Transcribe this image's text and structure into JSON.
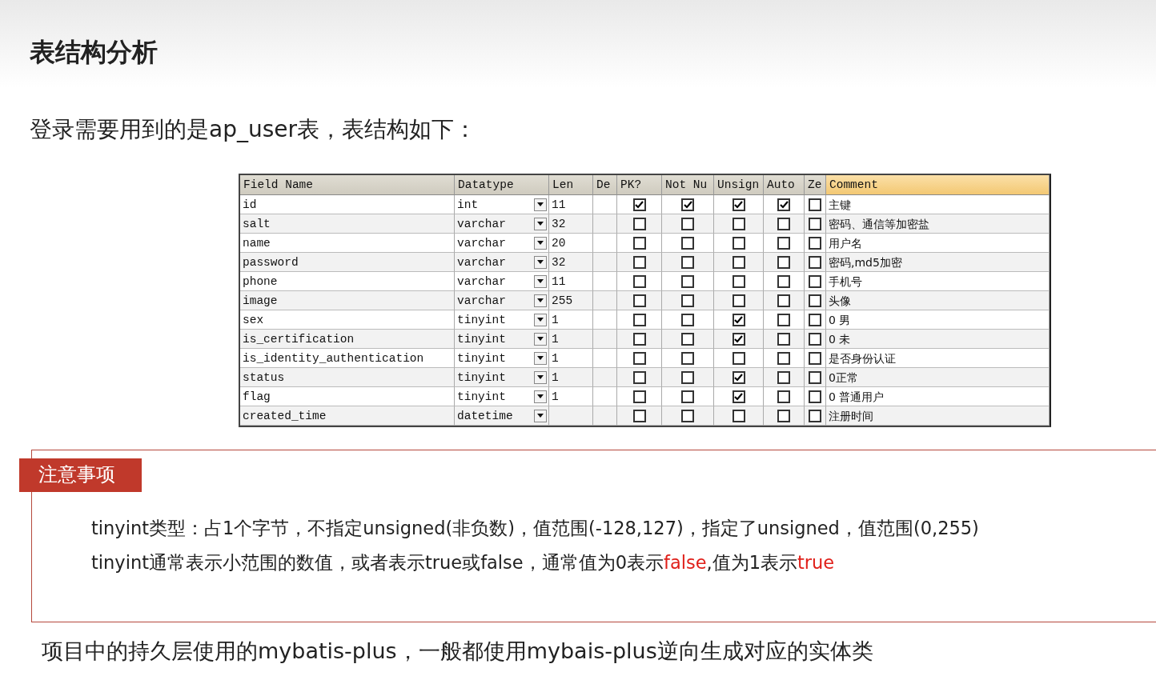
{
  "title": "表结构分析",
  "intro": "登录需要用到的是ap_user表，表结构如下：",
  "table": {
    "columns": [
      "Field Name",
      "Datatype",
      "Len",
      "De",
      "PK?",
      "Not Nu",
      "Unsign",
      "Auto",
      "Ze",
      "Comment"
    ],
    "rows": [
      {
        "field": "id",
        "datatype": "int",
        "len": "11",
        "pk": true,
        "not_null": true,
        "unsigned": true,
        "auto": true,
        "zerofill": false,
        "comment": "主键"
      },
      {
        "field": "salt",
        "datatype": "varchar",
        "len": "32",
        "pk": false,
        "not_null": false,
        "unsigned": false,
        "auto": false,
        "zerofill": false,
        "comment": "密码、通信等加密盐"
      },
      {
        "field": "name",
        "datatype": "varchar",
        "len": "20",
        "pk": false,
        "not_null": false,
        "unsigned": false,
        "auto": false,
        "zerofill": false,
        "comment": "用户名"
      },
      {
        "field": "password",
        "datatype": "varchar",
        "len": "32",
        "pk": false,
        "not_null": false,
        "unsigned": false,
        "auto": false,
        "zerofill": false,
        "comment": "密码,md5加密"
      },
      {
        "field": "phone",
        "datatype": "varchar",
        "len": "11",
        "pk": false,
        "not_null": false,
        "unsigned": false,
        "auto": false,
        "zerofill": false,
        "comment": "手机号"
      },
      {
        "field": "image",
        "datatype": "varchar",
        "len": "255",
        "pk": false,
        "not_null": false,
        "unsigned": false,
        "auto": false,
        "zerofill": false,
        "comment": "头像"
      },
      {
        "field": "sex",
        "datatype": "tinyint",
        "len": "1",
        "pk": false,
        "not_null": false,
        "unsigned": true,
        "auto": false,
        "zerofill": false,
        "comment": "0 男"
      },
      {
        "field": "is_certification",
        "datatype": "tinyint",
        "len": "1",
        "pk": false,
        "not_null": false,
        "unsigned": true,
        "auto": false,
        "zerofill": false,
        "comment": "0 未"
      },
      {
        "field": "is_identity_authentication",
        "datatype": "tinyint",
        "len": "1",
        "pk": false,
        "not_null": false,
        "unsigned": false,
        "auto": false,
        "zerofill": false,
        "comment": "是否身份认证"
      },
      {
        "field": "status",
        "datatype": "tinyint",
        "len": "1",
        "pk": false,
        "not_null": false,
        "unsigned": true,
        "auto": false,
        "zerofill": false,
        "comment": "0正常"
      },
      {
        "field": "flag",
        "datatype": "tinyint",
        "len": "1",
        "pk": false,
        "not_null": false,
        "unsigned": true,
        "auto": false,
        "zerofill": false,
        "comment": "0 普通用户"
      },
      {
        "field": "created_time",
        "datatype": "datetime",
        "pk": false,
        "not_null": false,
        "unsigned": false,
        "auto": false,
        "zerofill": false,
        "comment": "注册时间"
      }
    ]
  },
  "note": {
    "label": "注意事项",
    "lines": [
      [
        {
          "text": "tinyint类型：占1个字节，不指定unsigned(非负数)，值范围(-128,127)，指定了unsigned，值范围(0,255)",
          "kind": "plain"
        }
      ],
      [
        {
          "text": "tinyint通常表示小范围的数值，或者表示true或false，通常值为0表示",
          "kind": "plain"
        },
        {
          "text": "false",
          "kind": "accent"
        },
        {
          "text": ",值为1表示",
          "kind": "plain"
        },
        {
          "text": "true",
          "kind": "accent"
        }
      ]
    ]
  },
  "footer": "项目中的持久层使用的mybatis-plus，一般都使用mybais-plus逆向生成对应的实体类"
}
